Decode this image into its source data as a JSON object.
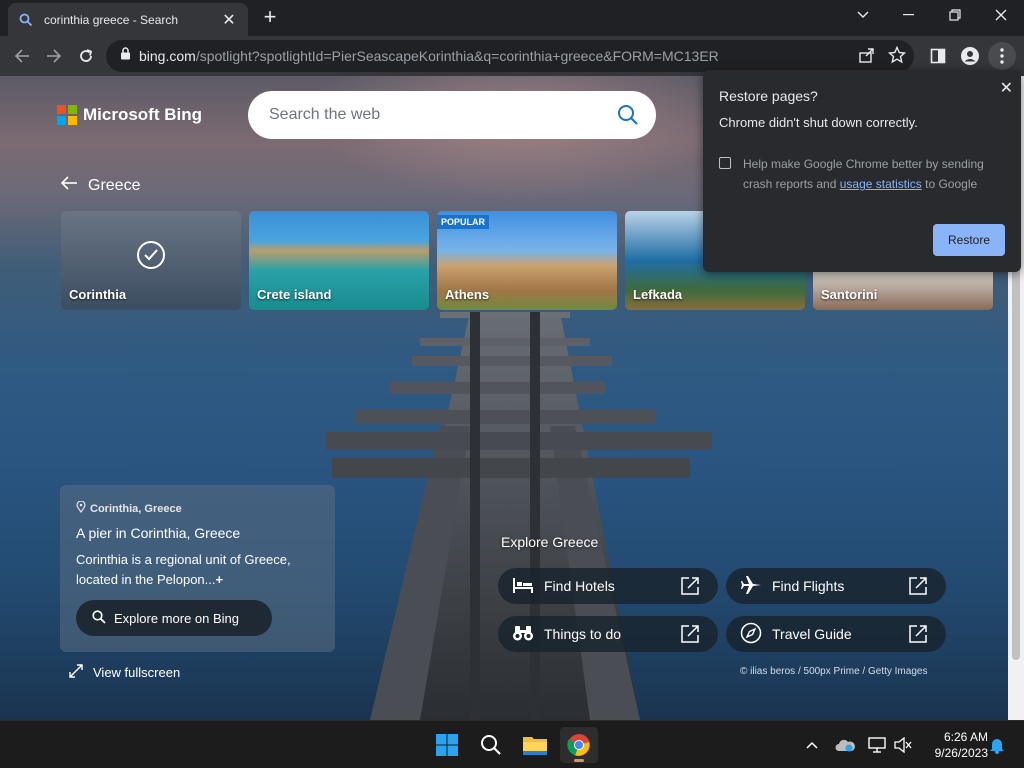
{
  "browser": {
    "tab_title": "corinthia greece - Search",
    "url_host": "bing.com",
    "url_path": "/spotlight?spotlightId=PierSeascapeKorinthia&q=corinthia+greece&FORM=MC13ER"
  },
  "bing": {
    "logo_text": "Microsoft Bing",
    "search_placeholder": "Search the web",
    "back_label": "Greece",
    "cards": [
      {
        "label": "Corinthia",
        "selected": true
      },
      {
        "label": "Crete island"
      },
      {
        "label": "Athens",
        "badge": "POPULAR"
      },
      {
        "label": "Lefkada"
      },
      {
        "label": "Santorini"
      }
    ],
    "info": {
      "location": "Corinthia, Greece",
      "heading": "A pier in Corinthia, Greece",
      "description": "Corinthia is a regional unit of Greece, located in the Pelopon...",
      "expand": "+",
      "explore_button": "Explore more on Bing"
    },
    "fullscreen_label": "View fullscreen",
    "explore_title": "Explore Greece",
    "quick_links": [
      "Find Hotels",
      "Find Flights",
      "Things to do",
      "Travel Guide"
    ],
    "credit": "© ilias beros / 500px Prime / Getty Images"
  },
  "popup": {
    "title": "Restore pages?",
    "message": "Chrome didn't shut down correctly.",
    "checkbox_text_1": "Help make Google Chrome better by sending crash reports and",
    "checkbox_link": "usage statistics",
    "checkbox_text_2": "to Google",
    "restore_button": "Restore"
  },
  "taskbar": {
    "time": "6:26 AM",
    "date": "9/26/2023"
  },
  "colors": {
    "accent_link": "#8ab4f8",
    "chrome_dark": "#202124",
    "bing_blue": "#1a73c9"
  }
}
